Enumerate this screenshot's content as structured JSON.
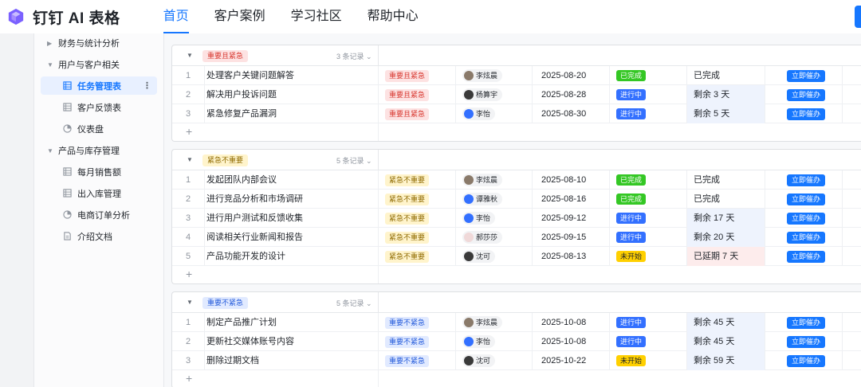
{
  "topnav": {
    "brand": "钉钉 AI 表格",
    "items": [
      {
        "label": "首页",
        "active": true
      },
      {
        "label": "客户案例",
        "active": false
      },
      {
        "label": "学习社区",
        "active": false
      },
      {
        "label": "帮助中心",
        "active": false
      }
    ]
  },
  "sidebar": {
    "groups": [
      {
        "label": "财务与统计分析",
        "expanded": false
      },
      {
        "label": "用户与客户相关",
        "expanded": true
      },
      {
        "label": "产品与库存管理",
        "expanded": true
      }
    ],
    "items": [
      {
        "label": "任务管理表",
        "icon": "grid-table-icon",
        "active": true
      },
      {
        "label": "客户反馈表",
        "icon": "grid-table-icon",
        "active": false
      },
      {
        "label": "仪表盘",
        "icon": "dashboard-icon",
        "active": false
      },
      {
        "label": "每月销售额",
        "icon": "grid-table-icon",
        "active": false
      },
      {
        "label": "出入库管理",
        "icon": "grid-table-icon",
        "active": false
      },
      {
        "label": "电商订单分析",
        "icon": "dashboard-icon",
        "active": false
      },
      {
        "label": "介绍文档",
        "icon": "document-icon",
        "active": false
      }
    ],
    "more": "⋮"
  },
  "groups": [
    {
      "tag": "重要且紧急",
      "color": "red",
      "count": "3 条记录",
      "rows": [
        {
          "idx": "1",
          "title": "处理客户关键问题解答",
          "priority": "重要且紧急",
          "owner": "李炫晨",
          "avatar": "face",
          "date": "2025-08-20",
          "status": "已完成",
          "status_type": "done",
          "remain": "已完成",
          "remain_bg": "none",
          "action": "立即催办"
        },
        {
          "idx": "2",
          "title": "解决用户投诉问题",
          "priority": "重要且紧急",
          "owner": "杨算宇",
          "avatar": "dark",
          "date": "2025-08-28",
          "status": "进行中",
          "status_type": "doing",
          "remain": "剩余 3 天",
          "remain_bg": "blue",
          "action": "立即催办"
        },
        {
          "idx": "3",
          "title": "紧急修复产品漏洞",
          "priority": "重要且紧急",
          "owner": "李怡",
          "avatar": "blue",
          "date": "2025-08-30",
          "status": "进行中",
          "status_type": "doing",
          "remain": "剩余 5 天",
          "remain_bg": "blue",
          "action": "立即催办"
        }
      ]
    },
    {
      "tag": "紧急不重要",
      "color": "yellow",
      "count": "5 条记录",
      "rows": [
        {
          "idx": "1",
          "title": "发起团队内部会议",
          "priority": "紧急不重要",
          "owner": "李炫晨",
          "avatar": "face",
          "date": "2025-08-10",
          "status": "已完成",
          "status_type": "done",
          "remain": "已完成",
          "remain_bg": "none",
          "action": "立即催办"
        },
        {
          "idx": "2",
          "title": "进行竞品分析和市场调研",
          "priority": "紧急不重要",
          "owner": "谭雅秋",
          "avatar": "blue",
          "date": "2025-08-16",
          "status": "已完成",
          "status_type": "done",
          "remain": "已完成",
          "remain_bg": "none",
          "action": "立即催办"
        },
        {
          "idx": "3",
          "title": "进行用户测试和反馈收集",
          "priority": "紧急不重要",
          "owner": "李怡",
          "avatar": "blue",
          "date": "2025-09-12",
          "status": "进行中",
          "status_type": "doing",
          "remain": "剩余 17 天",
          "remain_bg": "blue",
          "action": "立即催办"
        },
        {
          "idx": "4",
          "title": "阅读相关行业新闻和报告",
          "priority": "紧急不重要",
          "owner": "郝莎莎",
          "avatar": "light",
          "date": "2025-09-15",
          "status": "进行中",
          "status_type": "doing",
          "remain": "剩余 20 天",
          "remain_bg": "blue",
          "action": "立即催办"
        },
        {
          "idx": "5",
          "title": "产品功能开发的设计",
          "priority": "紧急不重要",
          "owner": "沈可",
          "avatar": "dark",
          "date": "2025-08-13",
          "status": "未开始",
          "status_type": "todo",
          "remain": "已延期 7 天",
          "remain_bg": "pink",
          "action": "立即催办"
        }
      ]
    },
    {
      "tag": "重要不紧急",
      "color": "blue",
      "count": "5 条记录",
      "rows": [
        {
          "idx": "1",
          "title": "制定产品推广计划",
          "priority": "重要不紧急",
          "owner": "李炫晨",
          "avatar": "face",
          "date": "2025-10-08",
          "status": "进行中",
          "status_type": "doing",
          "remain": "剩余 45 天",
          "remain_bg": "blue",
          "action": "立即催办"
        },
        {
          "idx": "2",
          "title": "更新社交媒体账号内容",
          "priority": "重要不紧急",
          "owner": "李怡",
          "avatar": "blue",
          "date": "2025-10-08",
          "status": "进行中",
          "status_type": "doing",
          "remain": "剩余 45 天",
          "remain_bg": "blue",
          "action": "立即催办"
        },
        {
          "idx": "3",
          "title": "删除过期文档",
          "priority": "重要不紧急",
          "owner": "沈可",
          "avatar": "dark",
          "date": "2025-10-22",
          "status": "未开始",
          "status_type": "todo",
          "remain": "剩余 59 天",
          "remain_bg": "blue",
          "action": "立即催办"
        }
      ]
    }
  ],
  "add_symbol": "+",
  "colors": {
    "accent": "#1677ff",
    "done": "#34c724",
    "doing": "#3370ff",
    "todo": "#ffd000"
  }
}
